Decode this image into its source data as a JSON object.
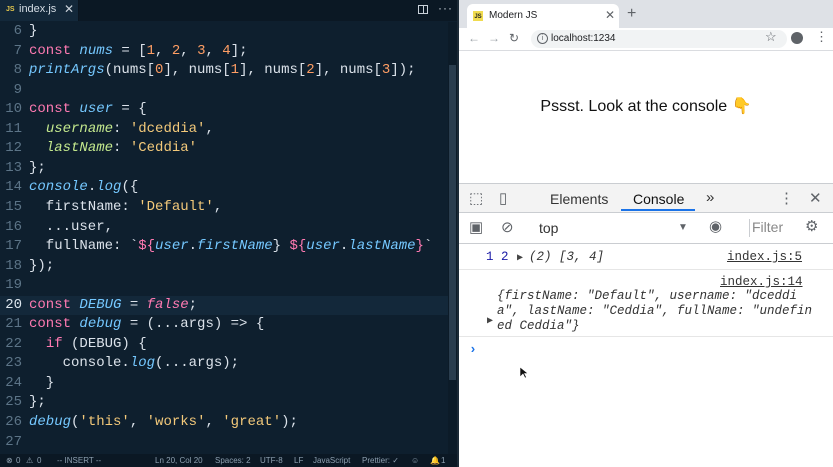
{
  "editor": {
    "tab": {
      "icon": "js-file-icon",
      "icon_text": "JS",
      "label": "index.js",
      "close": "✕"
    },
    "active_line": "20",
    "lines": [
      {
        "n": "6",
        "code": "}"
      },
      {
        "n": "7",
        "code": "const nums = [1, 2, 3, 4];"
      },
      {
        "n": "8",
        "code": "printArgs(nums[0], nums[1], nums[2], nums[3]);"
      },
      {
        "n": "9",
        "code": ""
      },
      {
        "n": "10",
        "code": "const user = {"
      },
      {
        "n": "11",
        "code": "  username: 'dceddia',"
      },
      {
        "n": "12",
        "code": "  lastName: 'Ceddia'"
      },
      {
        "n": "13",
        "code": "};"
      },
      {
        "n": "14",
        "code": "console.log({"
      },
      {
        "n": "15",
        "code": "  firstName: 'Default',"
      },
      {
        "n": "16",
        "code": "  ...user,"
      },
      {
        "n": "17",
        "code": "  fullName: `${user.firstName} ${user.lastName}`"
      },
      {
        "n": "18",
        "code": "});"
      },
      {
        "n": "19",
        "code": ""
      },
      {
        "n": "20",
        "code": "const DEBUG = false;"
      },
      {
        "n": "21",
        "code": "const debug = (...args) => {"
      },
      {
        "n": "22",
        "code": "  if (DEBUG) {"
      },
      {
        "n": "23",
        "code": "    console.log(...args);"
      },
      {
        "n": "24",
        "code": "  }"
      },
      {
        "n": "25",
        "code": "};"
      },
      {
        "n": "26",
        "code": "debug('this', 'works', 'great');"
      },
      {
        "n": "27",
        "code": ""
      }
    ],
    "status": {
      "errors": "0",
      "warnings": "0",
      "mode": "-- INSERT --",
      "position": "Ln 20, Col 20",
      "spaces": "Spaces: 2",
      "encoding": "UTF-8",
      "eol": "LF",
      "language": "JavaScript",
      "formatter": "Prettier: ✓",
      "notifications": "1"
    }
  },
  "browser": {
    "tab_title": "Modern JS",
    "tab_icon_text": "JS",
    "url": "localhost:1234",
    "page_message": "Pssst. Look at the console 👇",
    "devtools": {
      "tabs": [
        "Elements",
        "Console"
      ],
      "active_tab": "Console",
      "context": "top",
      "filter_placeholder": "Filter",
      "log1": {
        "source": "index.js:5",
        "args": "1 2",
        "array": "(2) [3, 4]"
      },
      "log2": {
        "source": "index.js:14",
        "object": "{firstName: \"Default\", username: \"dceddia\", lastName: \"Ceddia\", fullName: \"undefined Ceddia\"}"
      },
      "prompt": "›"
    }
  }
}
